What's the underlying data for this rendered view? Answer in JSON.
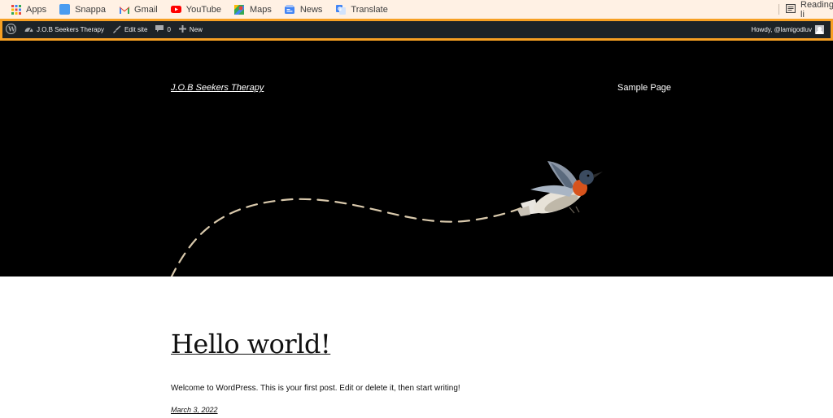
{
  "bookmarks": {
    "items": [
      {
        "label": "Apps",
        "icon": "apps-grid-icon"
      },
      {
        "label": "Snappa",
        "icon": "snappa-icon"
      },
      {
        "label": "Gmail",
        "icon": "gmail-icon"
      },
      {
        "label": "YouTube",
        "icon": "youtube-icon"
      },
      {
        "label": "Maps",
        "icon": "maps-icon"
      },
      {
        "label": "News",
        "icon": "news-icon"
      },
      {
        "label": "Translate",
        "icon": "translate-icon"
      }
    ],
    "reading_list": "Reading li"
  },
  "admin_bar": {
    "site_name": "J.O.B Seekers Therapy",
    "edit_site": "Edit site",
    "comments_count": "0",
    "new_label": "New",
    "howdy": "Howdy, @lamigodluv",
    "highlight_color": "#f7a023"
  },
  "header": {
    "site_title": "J.O.B Seekers Therapy",
    "nav_items": [
      "Sample Page"
    ]
  },
  "post": {
    "title": "Hello world!",
    "excerpt": "Welcome to WordPress. This is your first post. Edit or delete it, then start writing!",
    "date": "March 3, 2022"
  }
}
